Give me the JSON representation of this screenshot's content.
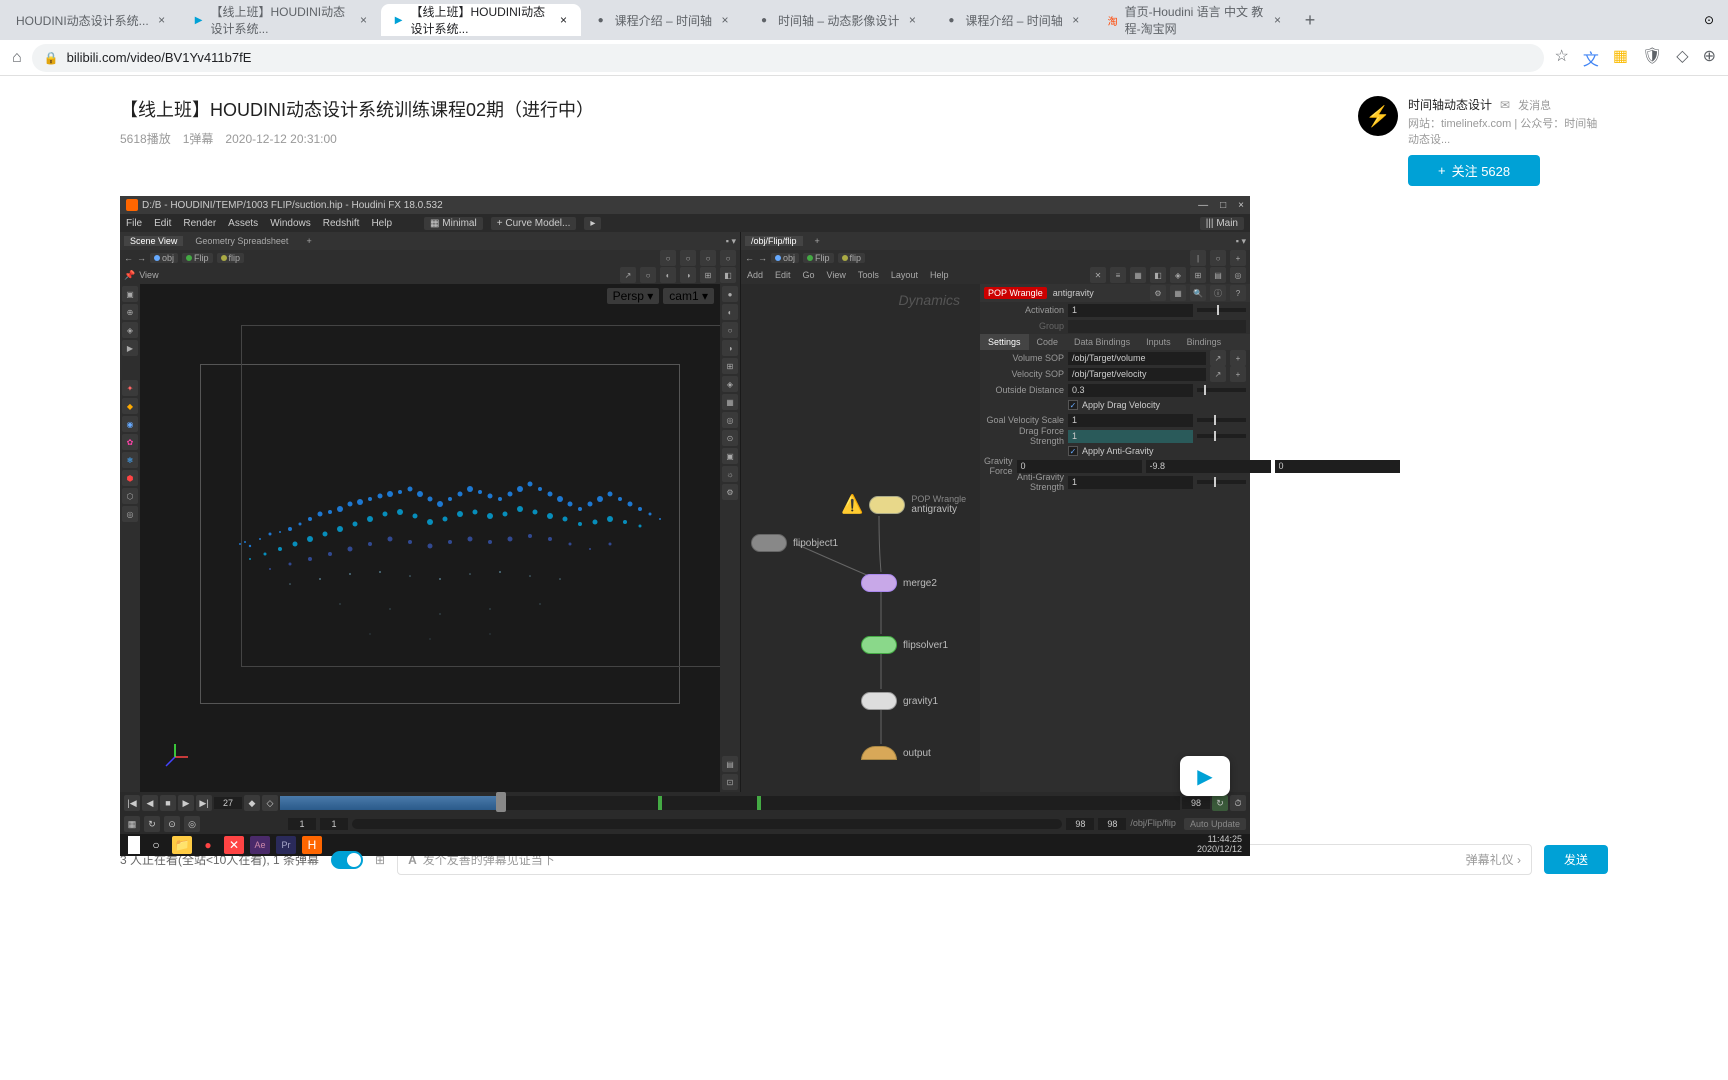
{
  "browser": {
    "tabs": [
      {
        "label": "HOUDINI动态设计系统...",
        "icon": ""
      },
      {
        "label": "【线上班】HOUDINI动态设计系统...",
        "icon": "📺"
      },
      {
        "label": "【线上班】HOUDINI动态设计系统...",
        "icon": "📺",
        "active": true
      },
      {
        "label": "课程介绍 – 时间轴",
        "icon": "●"
      },
      {
        "label": "时间轴 – 动态影像设计",
        "icon": "●"
      },
      {
        "label": "课程介绍 – 时间轴",
        "icon": "●"
      },
      {
        "label": "首页-Houdini 语言 中文 教程-淘宝网",
        "icon": "淘"
      }
    ],
    "url": "bilibili.com/video/BV1Yv411b7fE"
  },
  "page": {
    "title": "【线上班】HOUDINI动态设计系统训练课程02期（进行中）",
    "plays": "5618播放",
    "danmaku": "1弹幕",
    "date": "2020-12-12 20:31:00",
    "author": {
      "name": "时间轴动态设计",
      "msg": "发消息",
      "site": "网站：timelinefx.com | 公众号：时间轴动态设...",
      "follow": "关注 5628"
    }
  },
  "houdini": {
    "title": "D:/B - HOUDINI/TEMP/1003 FLIP/suction.hip - Houdini FX 18.0.532",
    "menu": [
      "File",
      "Edit",
      "Render",
      "Assets",
      "Windows",
      "Redshift",
      "Help"
    ],
    "layout_label": "Minimal",
    "curve_label": "Curve Model...",
    "desktop_label": "Main",
    "left_tabs": [
      "Scene View",
      "Geometry Spreadsheet"
    ],
    "left_path": [
      "obj",
      "Flip",
      "flip"
    ],
    "view_label": "View",
    "persp": "Persp",
    "cam": "cam1",
    "right_tabs": [
      "/obj/Flip/flip"
    ],
    "right_path": [
      "obj",
      "Flip",
      "flip"
    ],
    "network_menu": [
      "Add",
      "Edit",
      "Go",
      "View",
      "Tools",
      "Layout",
      "Help"
    ],
    "dynamics": "Dynamics",
    "nodes": {
      "antigravity": "antigravity",
      "wrangle": "POP Wrangle",
      "flipobject": "flipobject1",
      "merge": "merge2",
      "flipsolver": "flipsolver1",
      "gravity": "gravity1",
      "output": "output"
    },
    "params": {
      "header_type": "POP Wrangle",
      "header_name": "antigravity",
      "activation_label": "Activation",
      "activation_val": "1",
      "group_label": "Group",
      "tabs": [
        "Settings",
        "Code",
        "Data Bindings",
        "Inputs",
        "Bindings"
      ],
      "volume_sop_label": "Volume SOP",
      "volume_sop_val": "/obj/Target/volume",
      "velocity_sop_label": "Velocity SOP",
      "velocity_sop_val": "/obj/Target/velocity",
      "outside_dist_label": "Outside Distance",
      "outside_dist_val": "0.3",
      "apply_drag_label": "Apply Drag Velocity",
      "goal_vel_label": "Goal Velocity Scale",
      "goal_vel_val": "1",
      "drag_force_label": "Drag Force Strength",
      "drag_force_val": "1",
      "apply_anti_label": "Apply Anti-Gravity",
      "gravity_force_label": "Gravity Force",
      "gravity_force_x": "0",
      "gravity_force_y": "-9.8",
      "gravity_force_z": "0",
      "anti_gravity_label": "Anti-Gravity Strength",
      "anti_gravity_val": "1"
    },
    "timeline": {
      "frame": "27",
      "start": "1",
      "start2": "1",
      "end": "98",
      "end2": "98"
    },
    "status": {
      "path": "/obj/Flip/flip",
      "update": "Auto Update",
      "time": "11:44:25",
      "date": "2020/12/12"
    }
  },
  "danmaku": {
    "viewers": "3 人正在看(全站<10人在看), 1 条弹幕",
    "placeholder": "发个友善的弹幕见证当下",
    "etiquette": "弹幕礼仪",
    "send": "发送"
  }
}
